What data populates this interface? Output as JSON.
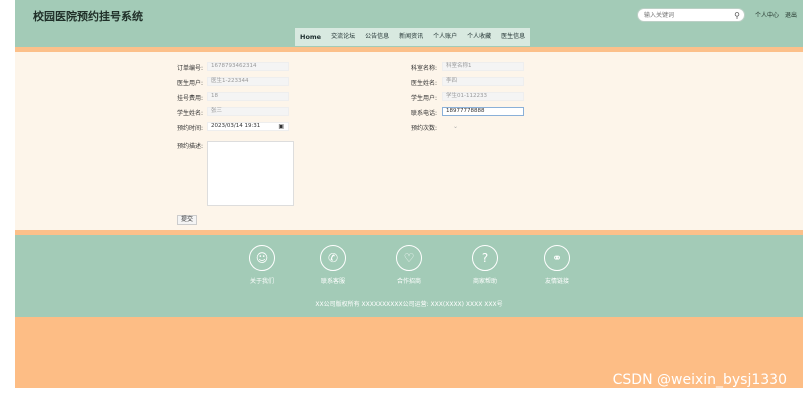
{
  "header": {
    "brand": "校园医院预约挂号系统",
    "search_placeholder": "输入关键词",
    "user_center": "个人中心",
    "logout": "退出"
  },
  "nav": [
    "Home",
    "交流论坛",
    "公告信息",
    "新闻资讯",
    "个人账户",
    "个人收藏",
    "医生信息"
  ],
  "form": {
    "left": [
      {
        "label": "订单编号:",
        "value": "1678793462314"
      },
      {
        "label": "医生用户:",
        "value": "医生1-223344"
      },
      {
        "label": "挂号费用:",
        "value": "18"
      },
      {
        "label": "学生姓名:",
        "value": "张三"
      },
      {
        "label": "预约时间:",
        "value": "2023/03/14 19:31"
      },
      {
        "label": "预约描述:",
        "value": ""
      }
    ],
    "right": [
      {
        "label": "科室名称:",
        "value": "科室名称1"
      },
      {
        "label": "医生姓名:",
        "value": "李四"
      },
      {
        "label": "学生用户:",
        "value": "学生01-112233"
      },
      {
        "label": "联系电话:",
        "value": "18977778888"
      },
      {
        "label": "预约次数:",
        "value": ""
      }
    ],
    "submit_label": "提交"
  },
  "footer": {
    "items": [
      {
        "label": "关于我们",
        "icon": "person-icon"
      },
      {
        "label": "联系客服",
        "icon": "phone-icon"
      },
      {
        "label": "合作招商",
        "icon": "handshake-icon"
      },
      {
        "label": "商家帮助",
        "icon": "help-icon"
      },
      {
        "label": "友情链接",
        "icon": "link-icon"
      }
    ],
    "copyright": "XX公司版权所有 XXXXXXXXXX公司运营: XXX(XXXX) XXXX XXX号"
  },
  "watermark": "CSDN @weixin_bysj1330"
}
